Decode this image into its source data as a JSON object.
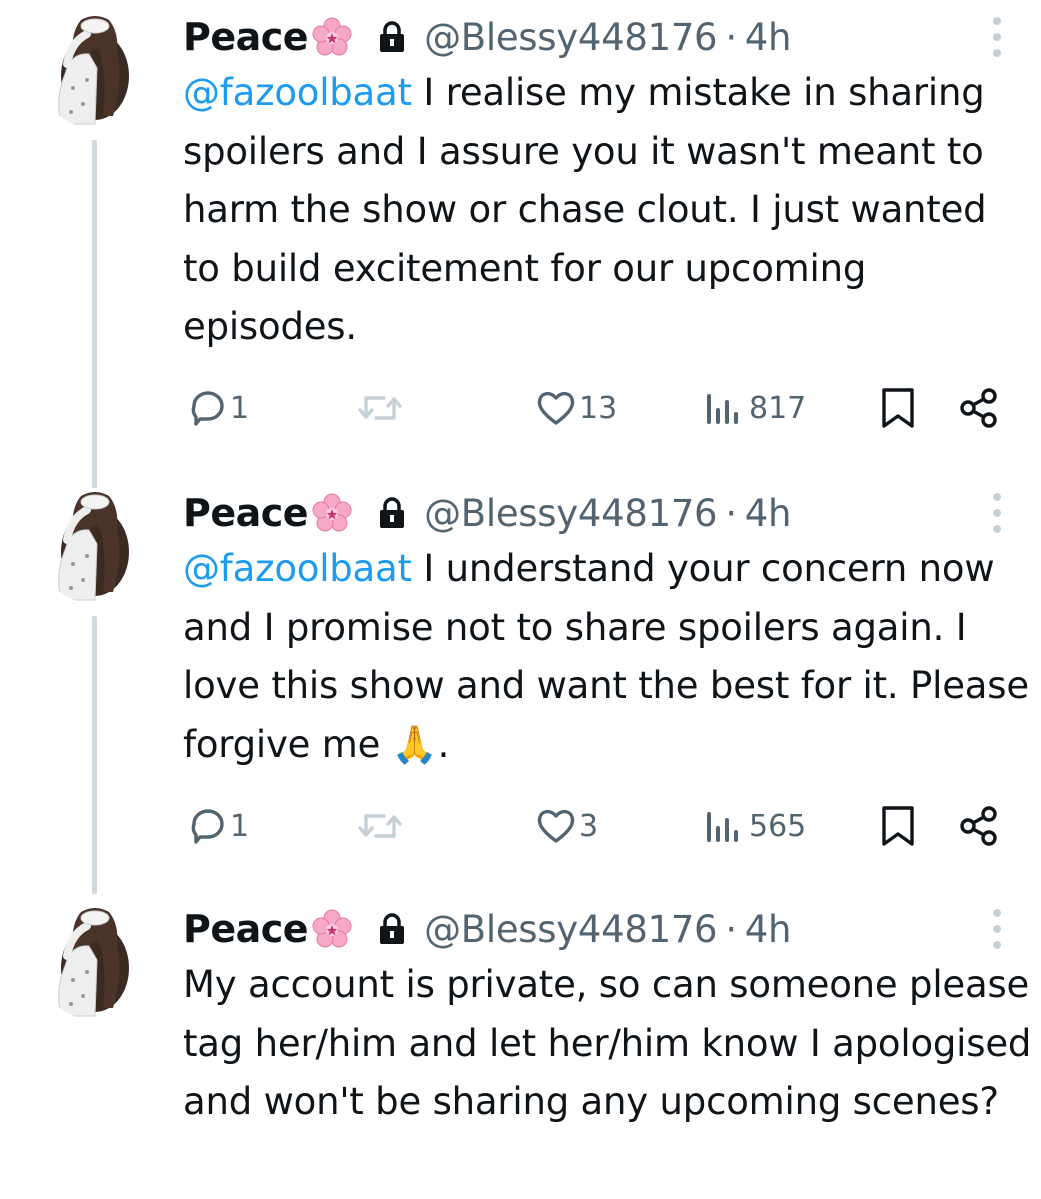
{
  "tweets": [
    {
      "name": "Peace",
      "handle": "@Blessy448176",
      "sep": "·",
      "time": "4h",
      "mention": "@fazoolbaat",
      "text": " I realise my mistake in sharing spoilers and I assure you it wasn't meant to harm the show or chase clout. I just wanted to build excitement for our upcoming episodes.",
      "replies": "1",
      "likes": "13",
      "views": "817"
    },
    {
      "name": "Peace",
      "handle": "@Blessy448176",
      "sep": "·",
      "time": "4h",
      "mention": "@fazoolbaat",
      "text": " I understand your concern now and I promise not to share spoilers again. I love this show and want the best for it. Please forgive me 🙏.",
      "replies": "1",
      "likes": "3",
      "views": "565"
    },
    {
      "name": "Peace",
      "handle": "@Blessy448176",
      "sep": "·",
      "time": "4h",
      "mention": "",
      "text": "My account is private, so can someone please tag her/him and let her/him know I apologised and won't be sharing any upcoming scenes?"
    }
  ],
  "icons": {
    "name_emoji": "cherry-blossom-icon",
    "protected": "lock-icon",
    "more": "more-vertical-icon",
    "reply": "reply-icon",
    "retweet": "retweet-icon",
    "like": "heart-icon",
    "views": "views-icon",
    "bookmark": "bookmark-icon",
    "share": "share-icon"
  },
  "colors": {
    "text": "#0f1419",
    "secondary": "#536471",
    "link": "#1d9bf0",
    "thread_line": "#cfd9de",
    "retweet_muted": "#c4cfd6"
  }
}
